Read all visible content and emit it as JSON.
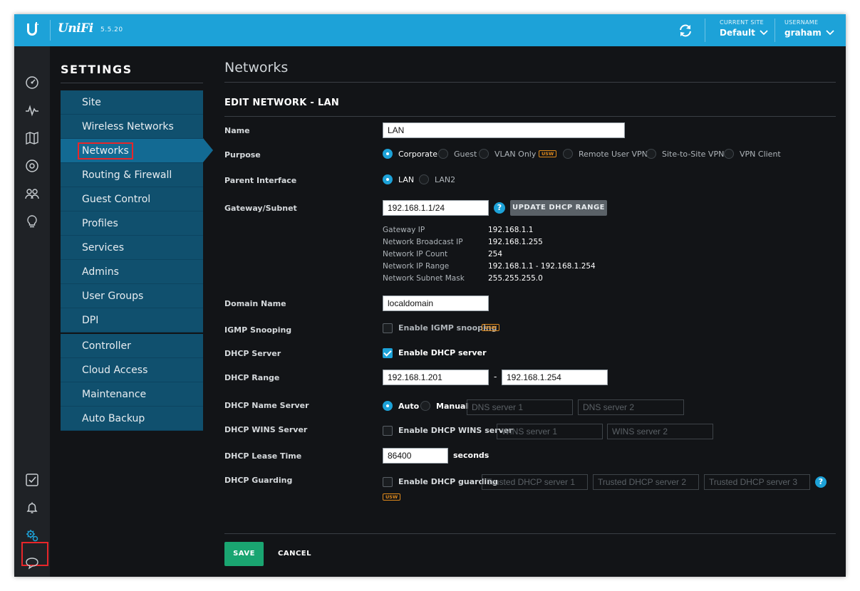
{
  "header": {
    "brand": "UniFi",
    "version": "5.5.20",
    "current_site_label": "CURRENT SITE",
    "current_site_value": "Default",
    "username_label": "USERNAME",
    "username_value": "graham"
  },
  "rail": {
    "icons": [
      "dashboard-icon",
      "statistics-icon",
      "map-icon",
      "devices-icon",
      "clients-icon",
      "insights-icon",
      "tasks-icon",
      "alerts-icon",
      "settings-icon",
      "support-icon"
    ],
    "active": "settings-icon"
  },
  "settings": {
    "title": "SETTINGS",
    "menu": [
      {
        "label": "Site"
      },
      {
        "label": "Wireless Networks"
      },
      {
        "label": "Networks"
      },
      {
        "label": "Routing & Firewall"
      },
      {
        "label": "Guest Control"
      },
      {
        "label": "Profiles"
      },
      {
        "label": "Services"
      },
      {
        "label": "Admins"
      },
      {
        "label": "User Groups"
      },
      {
        "label": "DPI"
      },
      {
        "label": "Controller"
      },
      {
        "label": "Cloud Access"
      },
      {
        "label": "Maintenance"
      },
      {
        "label": "Auto Backup"
      }
    ],
    "active_item": "Networks"
  },
  "page": {
    "title": "Networks",
    "section_title": "EDIT NETWORK - LAN"
  },
  "form": {
    "name": {
      "label": "Name",
      "value": "LAN"
    },
    "purpose": {
      "label": "Purpose",
      "options": [
        "Corporate",
        "Guest",
        "VLAN Only",
        "Remote User VPN",
        "Site-to-Site VPN",
        "VPN Client"
      ],
      "selected": "Corporate",
      "usw_badge": "USW"
    },
    "parent_interface": {
      "label": "Parent Interface",
      "options": [
        "LAN",
        "LAN2"
      ],
      "selected": "LAN"
    },
    "gateway_subnet": {
      "label": "Gateway/Subnet",
      "value": "192.168.1.1/24",
      "help": "?",
      "update_button": "UPDATE DHCP RANGE"
    },
    "network_info": [
      {
        "label": "Gateway IP",
        "value": "192.168.1.1"
      },
      {
        "label": "Network Broadcast IP",
        "value": "192.168.1.255"
      },
      {
        "label": "Network IP Count",
        "value": "254"
      },
      {
        "label": "Network IP Range",
        "value": "192.168.1.1 - 192.168.1.254"
      },
      {
        "label": "Network Subnet Mask",
        "value": "255.255.255.0"
      }
    ],
    "domain_name": {
      "label": "Domain Name",
      "value": "localdomain"
    },
    "igmp": {
      "label": "IGMP Snooping",
      "checkbox_label": "Enable IGMP snooping",
      "checked": false,
      "badge": "USW"
    },
    "dhcp_server": {
      "label": "DHCP Server",
      "checkbox_label": "Enable DHCP server",
      "checked": true
    },
    "dhcp_range": {
      "label": "DHCP Range",
      "start": "192.168.1.201",
      "separator": "-",
      "end": "192.168.1.254"
    },
    "dhcp_name_server": {
      "label": "DHCP Name Server",
      "options": [
        "Auto",
        "Manual"
      ],
      "selected": "Auto",
      "placeholder_1": "DNS server 1",
      "placeholder_2": "DNS server 2"
    },
    "dhcp_wins": {
      "label": "DHCP WINS Server",
      "checkbox_label": "Enable DHCP WINS server",
      "checked": false,
      "placeholder_1": "WINS server 1",
      "placeholder_2": "WINS server 2"
    },
    "lease_time": {
      "label": "DHCP Lease Time",
      "value": "86400",
      "unit": "seconds"
    },
    "dhcp_guarding": {
      "label": "DHCP Guarding",
      "checkbox_label": "Enable DHCP guarding",
      "checked": false,
      "placeholder_1": "Trusted DHCP server 1",
      "placeholder_2": "Trusted DHCP server 2",
      "placeholder_3": "Trusted DHCP server 3",
      "help": "?",
      "badge": "USW"
    }
  },
  "actions": {
    "save": "SAVE",
    "cancel": "CANCEL"
  },
  "colors": {
    "accent": "#1da2d8",
    "save": "#1aa571",
    "menu_bg": "#10506e",
    "menu_active": "#136a93",
    "highlight": "#e8262a",
    "usw_badge": "#e08a1c"
  }
}
